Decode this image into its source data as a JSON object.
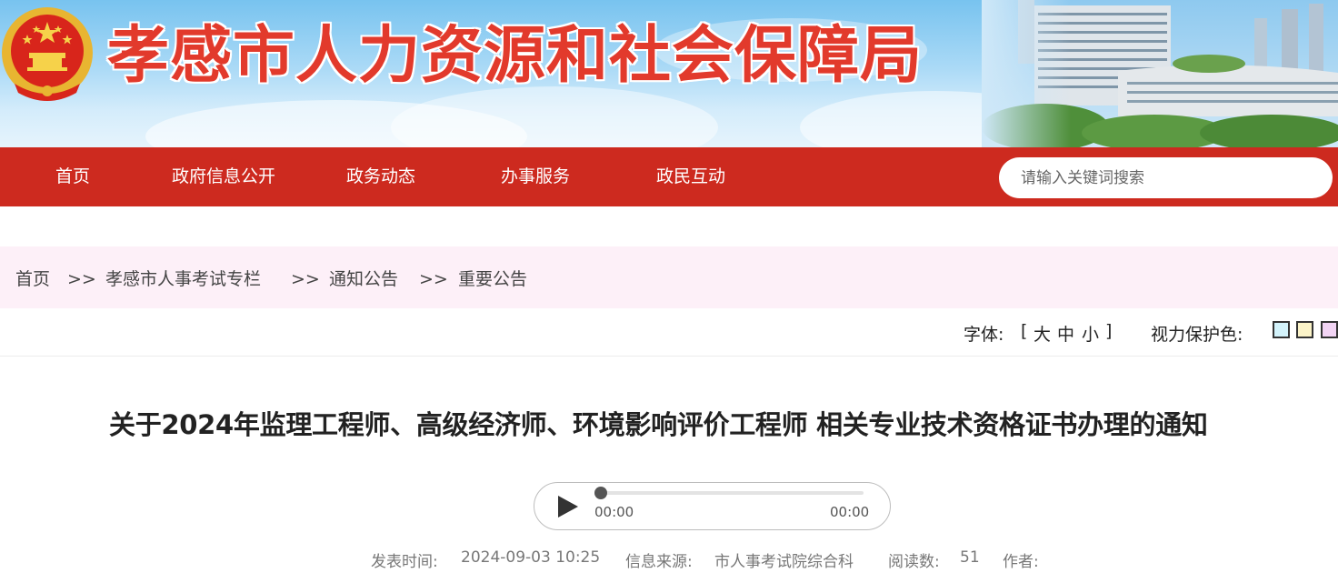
{
  "header": {
    "site_title": "孝感市人力资源和社会保障局"
  },
  "nav": {
    "items": [
      {
        "label": "首页"
      },
      {
        "label": "政府信息公开"
      },
      {
        "label": "政务动态"
      },
      {
        "label": "办事服务"
      },
      {
        "label": "政民互动"
      }
    ],
    "search_placeholder": "请输入关键词搜索"
  },
  "breadcrumb": {
    "items": [
      "首页",
      "孝感市人事考试专栏",
      "通知公告",
      "重要公告"
    ],
    "separator": ">>"
  },
  "tools": {
    "font_label": "字体:",
    "font_open": "[",
    "font_large": "大",
    "font_medium": "中",
    "font_small": "小",
    "font_close": "]",
    "eye_care_label": "视力保护色:",
    "eye_colors": [
      "#d3f3fb",
      "#fbf3c8",
      "#f2d4f4"
    ]
  },
  "article": {
    "title": "关于2024年监理工程师、高级经济师、环境影响评价工程师 相关专业技术资格证书办理的通知",
    "audio": {
      "current_time": "00:00",
      "duration": "00:00",
      "progress": 0
    },
    "meta": {
      "publish_label": "发表时间:",
      "publish_time": "2024-09-03 10:25",
      "source_label": "信息来源:",
      "source": "市人事考试院综合科",
      "reads_label": "阅读数:",
      "reads": "51",
      "author_label": "作者:"
    }
  },
  "colors": {
    "nav_red": "#cd2a1f",
    "title_red": "#e23a2c",
    "crumb_bg": "#fdf0f8"
  }
}
